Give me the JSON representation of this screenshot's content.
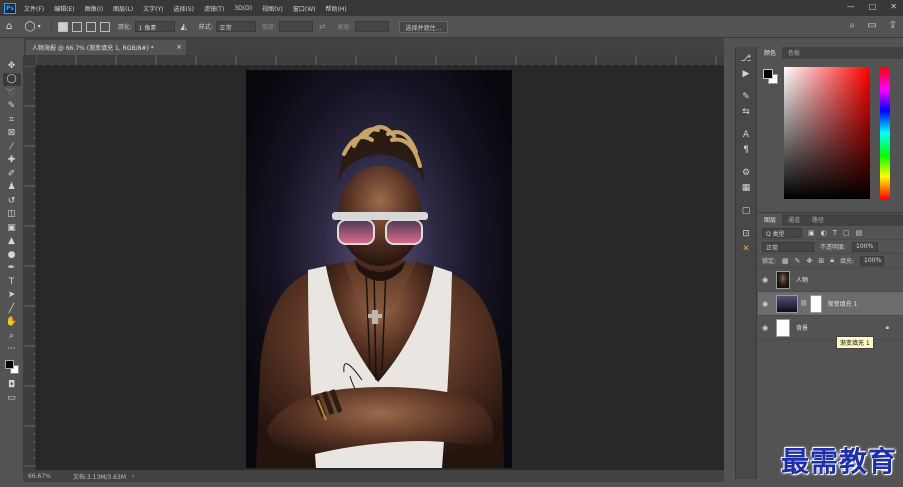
{
  "menubar": {
    "logo": "Ps",
    "items": [
      "文件(F)",
      "编辑(E)",
      "图像(I)",
      "图层(L)",
      "文字(Y)",
      "选择(S)",
      "滤镜(T)",
      "3D(D)",
      "视图(V)",
      "窗口(W)",
      "帮助(H)"
    ],
    "controls": [
      "—",
      "□",
      "✕"
    ]
  },
  "options": {
    "feather_label": "羽化:",
    "feather_value": "1 像素",
    "style_label": "样式:",
    "style_value": "正常",
    "width_label": "宽度:",
    "height_label": "高度:",
    "select_mask": "选择并遮住..."
  },
  "document": {
    "tab_title": "人物海报 @ 66.7% (渐变填充 1, RGB/8#) *",
    "tab_close": "×",
    "zoom": "66.67%",
    "doc_size": "文档:3.13M/3.63M"
  },
  "color_panel": {
    "tabs": [
      "颜色",
      "色板"
    ],
    "fg_color": "#000000",
    "bg_color": "#ffffff"
  },
  "layers_panel": {
    "tabs": [
      "图层",
      "通道",
      "路径"
    ],
    "filter_label": "Q 类型",
    "blend_mode": "正常",
    "opacity_label": "不透明度:",
    "opacity_value": "100%",
    "lock_label": "锁定:",
    "fill_label": "填充:",
    "fill_value": "100%",
    "layers": [
      {
        "name": "人物"
      },
      {
        "name": "渐变填充 1"
      },
      {
        "name": "背景"
      }
    ],
    "tooltip": "渐变填充 1"
  },
  "watermark": "最需教育"
}
